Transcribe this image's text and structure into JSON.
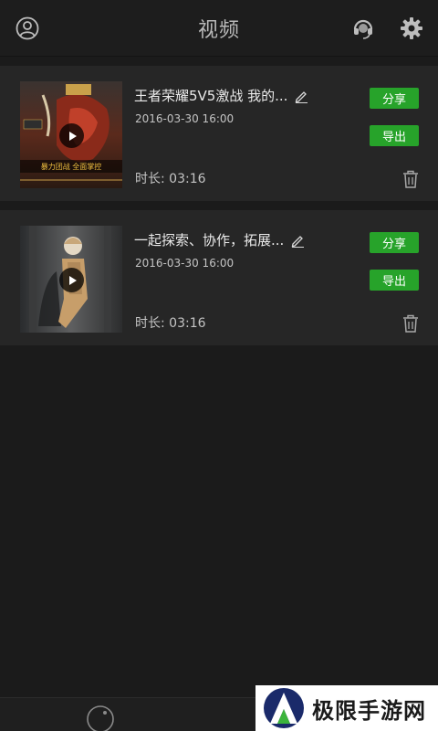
{
  "header": {
    "title": "视频",
    "icons": {
      "left": "user-icon",
      "support": "headset-icon",
      "settings": "gear-icon"
    }
  },
  "videos": [
    {
      "title": "王者荣耀5V5激战 我的...",
      "date": "2016-03-30  16:00",
      "duration": "时长: 03:16",
      "share_label": "分享",
      "export_label": "导出",
      "thumb_caption": "暴力团战 全面掌控"
    },
    {
      "title": "一起探索、协作，拓展...",
      "date": "2016-03-30  16:00",
      "duration": "时长: 03:16",
      "share_label": "分享",
      "export_label": "导出"
    }
  ],
  "watermark": {
    "text": "极限手游网"
  },
  "colors": {
    "accent": "#27a32a",
    "background": "#1b1b1b",
    "card": "#262626"
  }
}
